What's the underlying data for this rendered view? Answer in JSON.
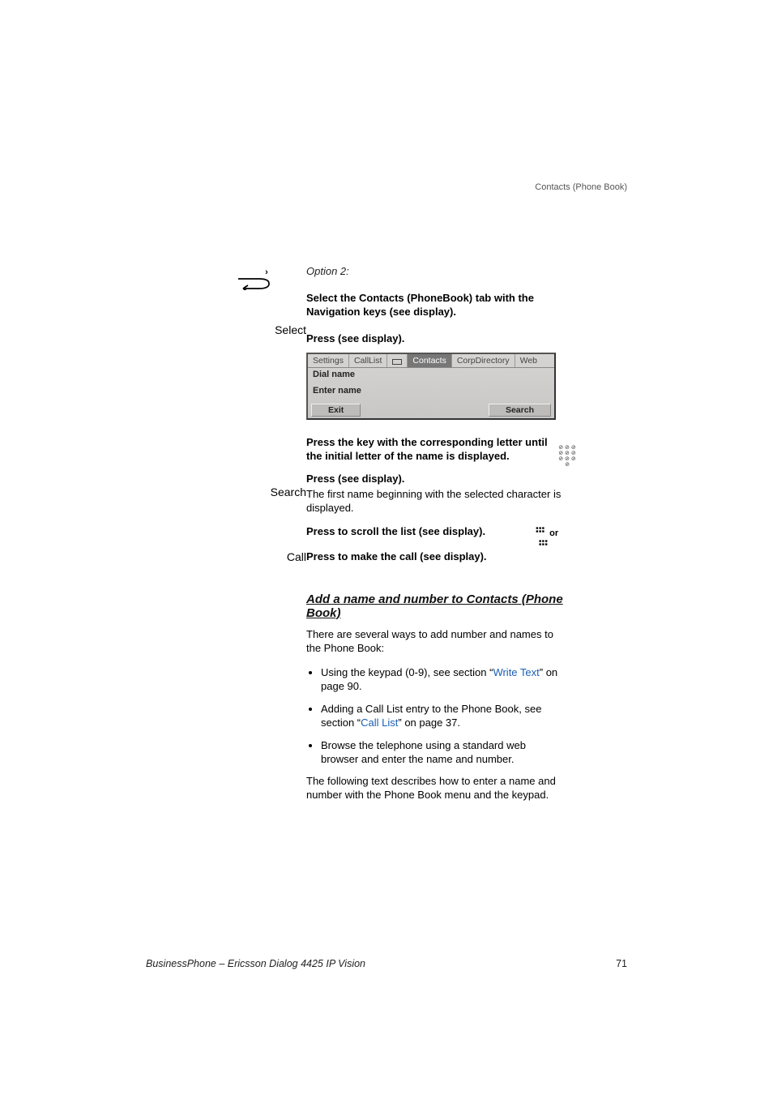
{
  "header": {
    "title": "Contacts (Phone Book)"
  },
  "option2": {
    "label": "Option 2:",
    "nav_instruction": "Select the Contacts (PhoneBook) tab with the Navigation keys (see display)."
  },
  "select_row": {
    "label": "Select",
    "text": "Press (see display)."
  },
  "display": {
    "tabs": {
      "settings": "Settings",
      "calllist": "CallList",
      "contacts": "Contacts",
      "corpdir": "CorpDirectory",
      "web": "Web"
    },
    "dial_name": "Dial name",
    "enter_name": "Enter name",
    "exit": "Exit",
    "search": "Search"
  },
  "keypad_row": {
    "text": "Press the key with the corresponding letter until the initial letter of the name is displayed."
  },
  "search_row": {
    "label": "Search",
    "bold": "Press (see display).",
    "plain": "The first name beginning with the selected character is displayed."
  },
  "scroll_row": {
    "or": "or",
    "text": "Press to scroll the list (see display)."
  },
  "call_row": {
    "label": "Call",
    "text": "Press to make the call (see display)."
  },
  "addsection": {
    "heading": "Add a name and number to Contacts (Phone Book)",
    "intro": "There are several ways to add number and names to the Phone Book:",
    "bullet1_a": "Using the keypad (0-9), see section “",
    "bullet1_link": "Write Text",
    "bullet1_b": "” on page 90.",
    "bullet2_a": "Adding a Call List entry to the Phone Book, see section “",
    "bullet2_link": "Call List",
    "bullet2_b": "” on page 37.",
    "bullet3": "Browse the telephone using a standard web browser and enter the name and number.",
    "outro": "The following text describes how to enter a name and number with the Phone Book menu and the keypad."
  },
  "footer": {
    "product": "BusinessPhone – Ericsson Dialog 4425 IP Vision",
    "page": "71"
  }
}
